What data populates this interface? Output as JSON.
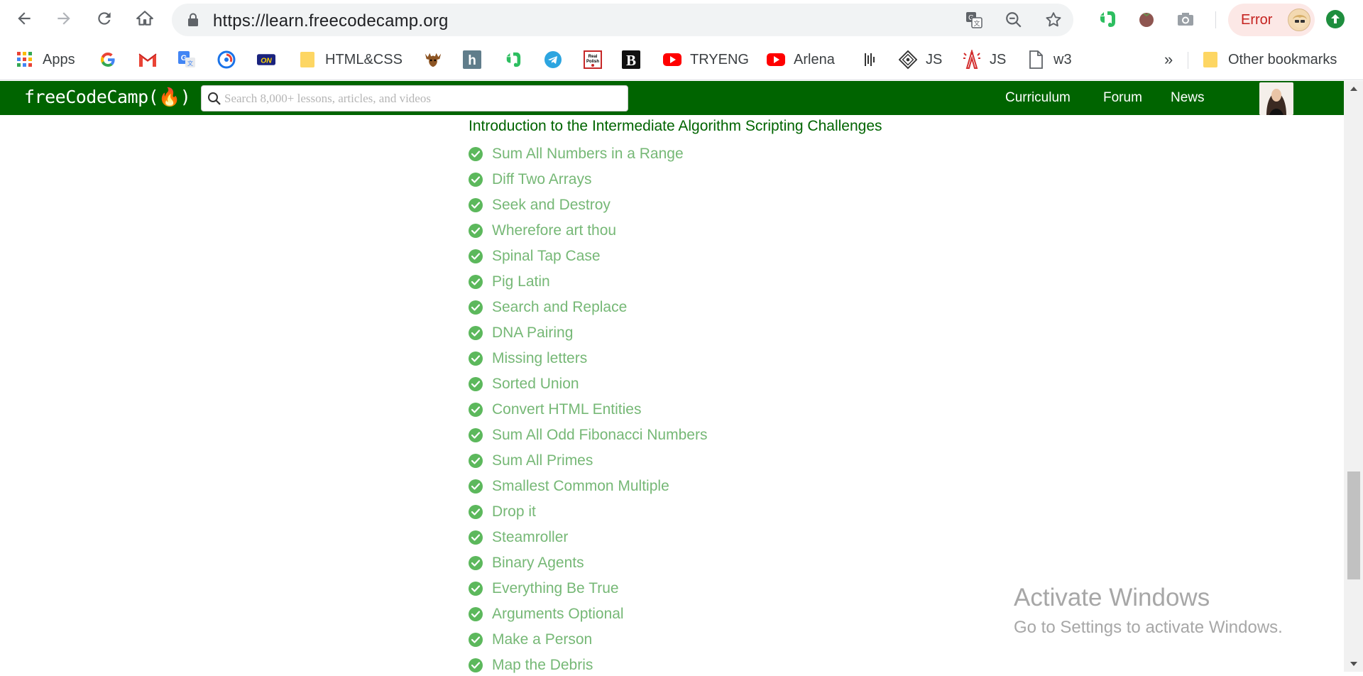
{
  "browser": {
    "url": "https://learn.freecodecamp.org",
    "error_label": "Error"
  },
  "bookmarks": [
    {
      "label": "Apps",
      "icon": "apps-grid-icon"
    },
    {
      "label": "",
      "icon": "google-icon"
    },
    {
      "label": "",
      "icon": "gmail-icon"
    },
    {
      "label": "",
      "icon": "google-translate-icon"
    },
    {
      "label": "",
      "icon": "sync-circle-icon"
    },
    {
      "label": "",
      "icon": "on-badge-icon"
    },
    {
      "label": "HTML&CSS",
      "icon": "folder-icon"
    },
    {
      "label": "",
      "icon": "moose-icon"
    },
    {
      "label": "",
      "icon": "h-letter-icon"
    },
    {
      "label": "",
      "icon": "evernote-icon"
    },
    {
      "label": "",
      "icon": "telegram-icon"
    },
    {
      "label": "",
      "icon": "real-polish-icon"
    },
    {
      "label": "",
      "icon": "b-letter-icon"
    },
    {
      "label": "TRYENG",
      "icon": "youtube-icon"
    },
    {
      "label": "Arlena",
      "icon": "youtube-icon"
    },
    {
      "label": "",
      "icon": "bars-icon"
    },
    {
      "label": "JS",
      "icon": "diamond-icon"
    },
    {
      "label": "JS",
      "icon": "tower-icon"
    },
    {
      "label": "w3",
      "icon": "page-icon"
    }
  ],
  "bookmarks_more": "»",
  "other_bookmarks": "Other bookmarks",
  "fcc": {
    "logo": "freeCodeCamp(🔥)",
    "search_placeholder": "Search 8,000+ lessons, articles, and videos",
    "nav_links": [
      "Curriculum",
      "Forum",
      "News"
    ]
  },
  "content": {
    "section_title": "Introduction to the Intermediate Algorithm Scripting Challenges",
    "lessons": [
      "Sum All Numbers in a Range",
      "Diff Two Arrays",
      "Seek and Destroy",
      "Wherefore art thou",
      "Spinal Tap Case",
      "Pig Latin",
      "Search and Replace",
      "DNA Pairing",
      "Missing letters",
      "Sorted Union",
      "Convert HTML Entities",
      "Sum All Odd Fibonacci Numbers",
      "Sum All Primes",
      "Smallest Common Multiple",
      "Drop it",
      "Steamroller",
      "Binary Agents",
      "Everything Be True",
      "Arguments Optional",
      "Make a Person",
      "Map the Debris"
    ]
  },
  "watermark": {
    "title": "Activate Windows",
    "subtitle": "Go to Settings to activate Windows."
  },
  "colors": {
    "fcc_green": "#006400",
    "lesson_text": "#76b876",
    "check_fill": "#5cb85c"
  }
}
